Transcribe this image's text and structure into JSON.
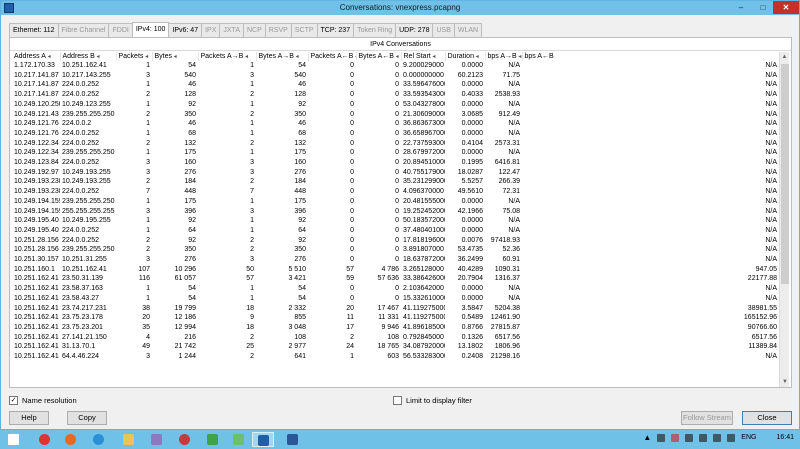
{
  "window": {
    "title": "Conversations: vnexpress.pcapng"
  },
  "tabs": [
    {
      "label": "Ethernet: 112",
      "enabled": true
    },
    {
      "label": "Fibre Channel",
      "enabled": false
    },
    {
      "label": "FDDI",
      "enabled": false
    },
    {
      "label": "IPv4: 100",
      "enabled": true,
      "active": true
    },
    {
      "label": "IPv6: 47",
      "enabled": true
    },
    {
      "label": "IPX",
      "enabled": false
    },
    {
      "label": "JXTA",
      "enabled": false
    },
    {
      "label": "NCP",
      "enabled": false
    },
    {
      "label": "RSVP",
      "enabled": false
    },
    {
      "label": "SCTP",
      "enabled": false
    },
    {
      "label": "TCP: 237",
      "enabled": true
    },
    {
      "label": "Token Ring",
      "enabled": false
    },
    {
      "label": "UDP: 278",
      "enabled": true
    },
    {
      "label": "USB",
      "enabled": false
    },
    {
      "label": "WLAN",
      "enabled": false
    }
  ],
  "panel": {
    "title": "IPv4 Conversations"
  },
  "columns": [
    "Address A",
    "Address B",
    "Packets",
    "Bytes",
    "Packets A→B",
    "Bytes A→B",
    "Packets A←B",
    "Bytes A←B",
    "Rel Start",
    "Duration",
    "bps A→B",
    "bps A←B"
  ],
  "rows": [
    [
      "1.172.170.33",
      "10.251.162.41",
      "1",
      "54",
      "1",
      "54",
      "0",
      "0",
      "9.200029000",
      "0.0000",
      "N/A",
      "N/A"
    ],
    [
      "10.217.141.87",
      "10.217.143.255",
      "3",
      "540",
      "3",
      "540",
      "0",
      "0",
      "0.000000000",
      "60.2123",
      "71.75",
      "N/A"
    ],
    [
      "10.217.141.87",
      "224.0.0.252",
      "1",
      "46",
      "1",
      "46",
      "0",
      "0",
      "33.596476000",
      "0.0000",
      "N/A",
      "N/A"
    ],
    [
      "10.217.141.87",
      "224.0.0.252",
      "2",
      "128",
      "2",
      "128",
      "0",
      "0",
      "33.593543000",
      "0.4033",
      "2538.93",
      "N/A"
    ],
    [
      "10.249.120.250",
      "10.249.123.255",
      "1",
      "92",
      "1",
      "92",
      "0",
      "0",
      "53.043278000",
      "0.0000",
      "N/A",
      "N/A"
    ],
    [
      "10.249.121.43",
      "239.255.255.250",
      "2",
      "350",
      "2",
      "350",
      "0",
      "0",
      "21.306090000",
      "3.0685",
      "912.49",
      "N/A"
    ],
    [
      "10.249.121.76",
      "224.0.0.2",
      "1",
      "46",
      "1",
      "46",
      "0",
      "0",
      "36.863673000",
      "0.0000",
      "N/A",
      "N/A"
    ],
    [
      "10.249.121.76",
      "224.0.0.252",
      "1",
      "68",
      "1",
      "68",
      "0",
      "0",
      "36.658967000",
      "0.0000",
      "N/A",
      "N/A"
    ],
    [
      "10.249.122.34",
      "224.0.0.252",
      "2",
      "132",
      "2",
      "132",
      "0",
      "0",
      "22.737593000",
      "0.4104",
      "2573.31",
      "N/A"
    ],
    [
      "10.249.122.34",
      "239.255.255.250",
      "1",
      "175",
      "1",
      "175",
      "0",
      "0",
      "28.679972000",
      "0.0000",
      "N/A",
      "N/A"
    ],
    [
      "10.249.123.84",
      "224.0.0.252",
      "3",
      "160",
      "3",
      "160",
      "0",
      "0",
      "20.894510000",
      "0.1995",
      "6416.81",
      "N/A"
    ],
    [
      "10.249.192.97",
      "10.249.193.255",
      "3",
      "276",
      "3",
      "276",
      "0",
      "0",
      "40.755179000",
      "18.0287",
      "122.47",
      "N/A"
    ],
    [
      "10.249.193.238",
      "10.249.193.255",
      "2",
      "184",
      "2",
      "184",
      "0",
      "0",
      "35.231299000",
      "5.5257",
      "266.39",
      "N/A"
    ],
    [
      "10.249.193.238",
      "224.0.0.252",
      "7",
      "448",
      "7",
      "448",
      "0",
      "0",
      "4.096370000",
      "49.5610",
      "72.31",
      "N/A"
    ],
    [
      "10.249.194.159",
      "239.255.255.250",
      "1",
      "175",
      "1",
      "175",
      "0",
      "0",
      "20.481555000",
      "0.0000",
      "N/A",
      "N/A"
    ],
    [
      "10.249.194.159",
      "255.255.255.255",
      "3",
      "396",
      "3",
      "396",
      "0",
      "0",
      "19.252452000",
      "42.1966",
      "75.08",
      "N/A"
    ],
    [
      "10.249.195.40",
      "10.249.195.255",
      "1",
      "92",
      "1",
      "92",
      "0",
      "0",
      "50.183572000",
      "0.0000",
      "N/A",
      "N/A"
    ],
    [
      "10.249.195.40",
      "224.0.0.252",
      "1",
      "64",
      "1",
      "64",
      "0",
      "0",
      "37.480401000",
      "0.0000",
      "N/A",
      "N/A"
    ],
    [
      "10.251.28.156",
      "224.0.0.252",
      "2",
      "92",
      "2",
      "92",
      "0",
      "0",
      "17.818196000",
      "0.0076",
      "97418.93",
      "N/A"
    ],
    [
      "10.251.28.156",
      "239.255.255.250",
      "2",
      "350",
      "2",
      "350",
      "0",
      "0",
      "3.891807000",
      "53.4735",
      "52.36",
      "N/A"
    ],
    [
      "10.251.30.157",
      "10.251.31.255",
      "3",
      "276",
      "3",
      "276",
      "0",
      "0",
      "18.637872000",
      "36.2499",
      "60.91",
      "N/A"
    ],
    [
      "10.251.160.1",
      "10.251.162.41",
      "107",
      "10 296",
      "50",
      "5 510",
      "57",
      "4 786",
      "3.265128000",
      "40.4289",
      "1090.31",
      "947.05"
    ],
    [
      "10.251.162.41",
      "23.50.31.139",
      "116",
      "61 057",
      "57",
      "3 421",
      "59",
      "57 636",
      "33.386426000",
      "20.7904",
      "1316.37",
      "22177.88"
    ],
    [
      "10.251.162.41",
      "23.58.37.163",
      "1",
      "54",
      "1",
      "54",
      "0",
      "0",
      "2.103642000",
      "0.0000",
      "N/A",
      "N/A"
    ],
    [
      "10.251.162.41",
      "23.58.43.27",
      "1",
      "54",
      "1",
      "54",
      "0",
      "0",
      "15.332610000",
      "0.0000",
      "N/A",
      "N/A"
    ],
    [
      "10.251.162.41",
      "23.74.217.231",
      "38",
      "19 799",
      "18",
      "2 332",
      "20",
      "17 467",
      "41.119275000",
      "3.5847",
      "5204.38",
      "38981.55"
    ],
    [
      "10.251.162.41",
      "23.75.23.178",
      "20",
      "12 186",
      "9",
      "855",
      "11",
      "11 331",
      "41.119275000",
      "0.5489",
      "12461.90",
      "165152.96"
    ],
    [
      "10.251.162.41",
      "23.75.23.201",
      "35",
      "12 994",
      "18",
      "3 048",
      "17",
      "9 946",
      "41.896185000",
      "0.8766",
      "27815.87",
      "90766.60"
    ],
    [
      "10.251.162.41",
      "27.141.21.150",
      "4",
      "216",
      "2",
      "108",
      "2",
      "108",
      "0.792845000",
      "0.1326",
      "6517.56",
      "6517.56"
    ],
    [
      "10.251.162.41",
      "31.13.70.1",
      "49",
      "21 742",
      "25",
      "2 977",
      "24",
      "18 765",
      "34.087920000",
      "13.1802",
      "1806.96",
      "11389.84"
    ],
    [
      "10.251.162.41",
      "64.4.46.224",
      "3",
      "1 244",
      "2",
      "641",
      "1",
      "603",
      "56.533283000",
      "0.2408",
      "21298.16",
      "N/A"
    ]
  ],
  "options": {
    "name_resolution": {
      "label": "Name resolution",
      "checked": true
    },
    "limit_filter": {
      "label": "Limit to display filter",
      "checked": false
    }
  },
  "buttons": {
    "help": "Help",
    "copy": "Copy",
    "follow_stream": "Follow Stream",
    "close": "Close"
  },
  "taskbar": {
    "language": "ENG",
    "time": "16:41"
  }
}
